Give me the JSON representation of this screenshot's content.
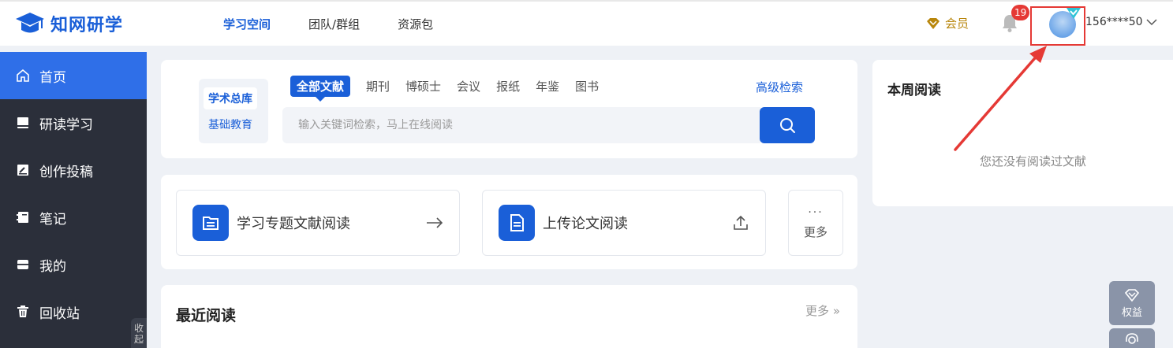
{
  "app": {
    "logo_text": "知网研学",
    "brand_color": "#1a5fd8"
  },
  "topnav": {
    "items": [
      {
        "label": "学习空间",
        "active": true
      },
      {
        "label": "团队/群组",
        "active": false
      },
      {
        "label": "资源包",
        "active": false
      }
    ]
  },
  "header_right": {
    "vip_label": "会员",
    "vip_icon": "diamond-icon",
    "notification_count": "19",
    "bell_icon": "bell-icon",
    "username": "156****50",
    "alert_color": "#e53935"
  },
  "sidebar": {
    "items": [
      {
        "label": "首页",
        "icon": "home-icon",
        "active": true
      },
      {
        "label": "研读学习",
        "icon": "book-icon",
        "active": false
      },
      {
        "label": "创作投稿",
        "icon": "edit-icon",
        "active": false
      },
      {
        "label": "笔记",
        "icon": "notebook-icon",
        "active": false
      },
      {
        "label": "我的",
        "icon": "folder-icon",
        "active": false
      },
      {
        "label": "回收站",
        "icon": "trash-icon",
        "active": false
      }
    ],
    "collapse_label": "收起"
  },
  "search": {
    "libraries": [
      "学术总库",
      "基础教育"
    ],
    "doc_types": [
      {
        "label": "全部文献",
        "active": true
      },
      {
        "label": "期刊",
        "active": false
      },
      {
        "label": "博硕士",
        "active": false
      },
      {
        "label": "会议",
        "active": false
      },
      {
        "label": "报纸",
        "active": false
      },
      {
        "label": "年鉴",
        "active": false
      },
      {
        "label": "图书",
        "active": false
      }
    ],
    "advanced_label": "高级检索",
    "placeholder": "输入关键词检索，马上在线阅读",
    "value": ""
  },
  "quick_actions": {
    "items": [
      {
        "label": "学习专题文献阅读",
        "icon": "list-doc-icon",
        "trailing": "arrow-right-icon"
      },
      {
        "label": "上传论文阅读",
        "icon": "document-icon",
        "trailing": "upload-icon"
      }
    ],
    "more_label": "更多"
  },
  "recent": {
    "title": "最近阅读",
    "more_label": "更多 »"
  },
  "weekly": {
    "title": "本周阅读",
    "empty_text": "您还没有阅读过文献"
  },
  "floating": {
    "benefits_label": "权益"
  }
}
